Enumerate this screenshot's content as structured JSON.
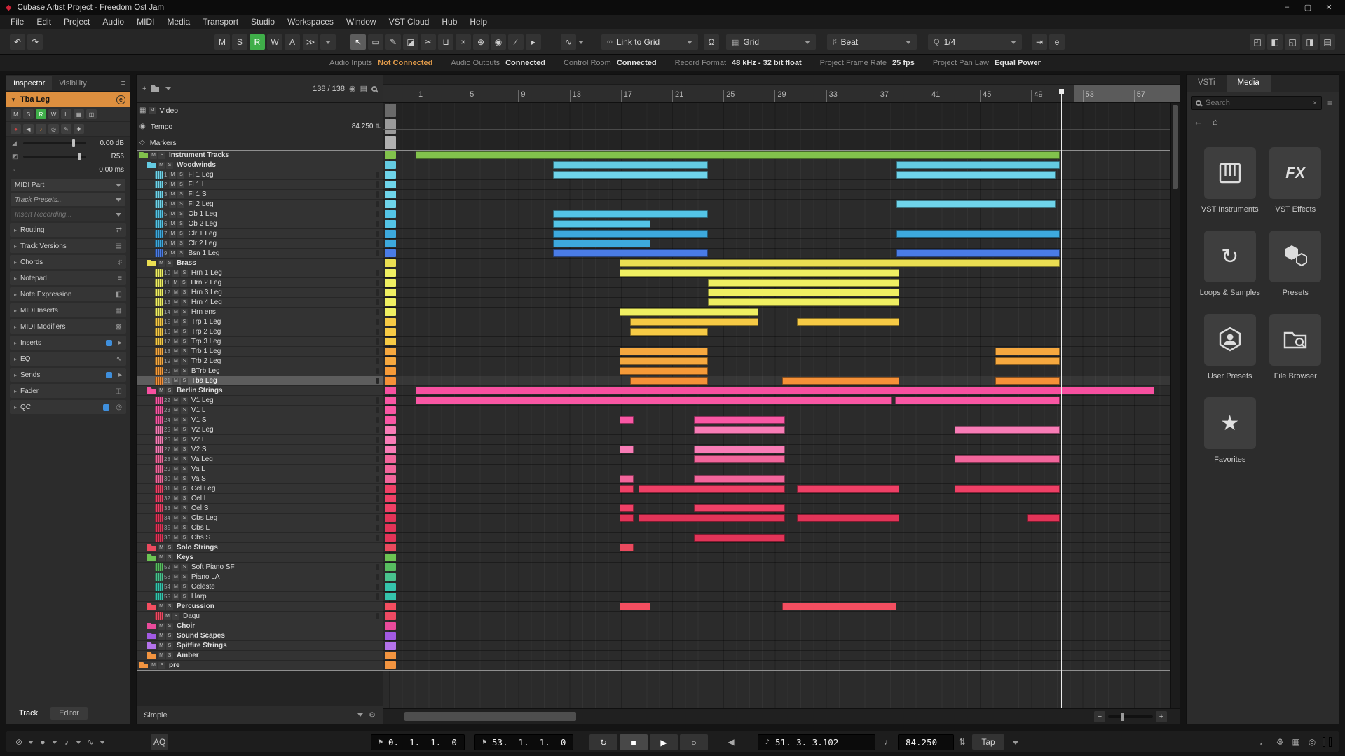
{
  "window": {
    "title": "Cubase Artist Project - Freedom Ost Jam",
    "controls": {
      "minimize": "–",
      "maximize": "▢",
      "close": "✕"
    }
  },
  "menu": {
    "items": [
      "File",
      "Edit",
      "Project",
      "Audio",
      "MIDI",
      "Media",
      "Transport",
      "Studio",
      "Workspaces",
      "Window",
      "VST Cloud",
      "Hub",
      "Help"
    ]
  },
  "icons": {
    "undo": "↶",
    "redo": "↷",
    "autoscroll": "≫",
    "automation": "∿",
    "link": "∞",
    "snap": "Ω",
    "grid": "▦",
    "beat": "♯",
    "quantize": "Q",
    "plus": "+",
    "camera": "◉",
    "list": "▤",
    "back": "←",
    "home": "⌂",
    "clear": "×",
    "menu": "≡",
    "cycle": "↻",
    "stop": "■",
    "play": "▶",
    "record": "○",
    "speaker": "◀",
    "noteq": "♪",
    "qnote": "♩",
    "spin": "⇅",
    "flag": "⚑",
    "e": "e",
    "gear": "⚙",
    "collapse": "▼"
  },
  "toolbar": {
    "states": [
      {
        "label": "M"
      },
      {
        "label": "S"
      },
      {
        "label": "R",
        "active": true
      },
      {
        "label": "W"
      },
      {
        "label": "A"
      }
    ],
    "tools": [
      {
        "name": "object-selection-tool",
        "glyph": "↖",
        "active": true
      },
      {
        "name": "range-selection-tool",
        "glyph": "▭"
      },
      {
        "name": "draw-tool",
        "glyph": "✎"
      },
      {
        "name": "erase-tool",
        "glyph": "◪"
      },
      {
        "name": "split-tool",
        "glyph": "✂"
      },
      {
        "name": "glue-tool",
        "glyph": "⊔"
      },
      {
        "name": "mute-tool",
        "glyph": "×"
      },
      {
        "name": "zoom-tool",
        "glyph": "⊕"
      },
      {
        "name": "comp-tool",
        "glyph": "◉"
      },
      {
        "name": "line-tool",
        "glyph": "∕"
      },
      {
        "name": "play-tool",
        "glyph": "▸"
      }
    ],
    "extras": [
      {
        "name": "iterative-quantize-button",
        "glyph": "⇥"
      },
      {
        "name": "quantize-panel-button",
        "glyph": "e"
      }
    ],
    "window_toggles": [
      {
        "name": "setup-workspace-button",
        "glyph": "◰"
      },
      {
        "name": "left-zone-toggle",
        "glyph": "◧"
      },
      {
        "name": "lower-zone-toggle",
        "glyph": "◱"
      },
      {
        "name": "right-zone-toggle",
        "glyph": "◨"
      },
      {
        "name": "transport-bar-toggle",
        "glyph": "▤"
      }
    ],
    "link_to_grid": "Link to Grid",
    "grid": "Grid",
    "beat": "Beat",
    "quantize": "1/4"
  },
  "infoline": {
    "items": [
      {
        "label": "Audio Inputs",
        "value": "Not Connected",
        "warn": true
      },
      {
        "label": "Audio Outputs",
        "value": "Connected"
      },
      {
        "label": "Control Room",
        "value": "Connected"
      },
      {
        "label": "Record Format",
        "value": "48 kHz - 32 bit float"
      },
      {
        "label": "Project Frame Rate",
        "value": "25 fps"
      },
      {
        "label": "Project Pan Law",
        "value": "Equal Power"
      }
    ]
  },
  "inspector": {
    "tabs": [
      {
        "label": "Inspector",
        "active": true
      },
      {
        "label": "Visibility"
      }
    ],
    "track_name": "Tba Leg",
    "track_color": "#dd8f3f",
    "state_buttons": [
      {
        "label": "M"
      },
      {
        "label": "S"
      },
      {
        "label": "R",
        "active": true
      },
      {
        "label": "W"
      },
      {
        "label": "L"
      }
    ],
    "record_row": [
      {
        "name": "record-enable-button",
        "glyph": "●",
        "color": "#c84545"
      },
      {
        "name": "monitor-button",
        "glyph": "◀",
        "color": "#bdbdbd"
      },
      {
        "name": "midi-note-button",
        "glyph": "♪",
        "color": "#d78b3c"
      },
      {
        "name": "lock-icon",
        "glyph": "◎",
        "color": "#bdbdbd"
      },
      {
        "name": "edit-icon",
        "glyph": "✎",
        "color": "#bdbdbd"
      },
      {
        "name": "freeze-icon",
        "glyph": "✱",
        "color": "#bdbdbd"
      }
    ],
    "volume": "0.00 dB",
    "pan": "R56",
    "delay": "0.00 ms",
    "rows": {
      "output": "MIDI Part",
      "presets": "Track Presets...",
      "insert_recording": "Insert Recording..."
    },
    "sections": [
      {
        "label": "Routing",
        "icon": "routing-icon"
      },
      {
        "label": "Track Versions",
        "icon": "track-versions-icon"
      },
      {
        "label": "Chords",
        "icon": "chords-icon"
      },
      {
        "label": "Notepad",
        "icon": "notepad-icon"
      },
      {
        "label": "Note Expression",
        "icon": "note-expression-icon"
      },
      {
        "label": "MIDI Inserts",
        "icon": "midi-inserts-icon"
      },
      {
        "label": "MIDI Modifiers",
        "icon": "midi-modifiers-icon"
      },
      {
        "label": "Inserts",
        "icon": "inserts-icon",
        "badge": true
      },
      {
        "label": "EQ",
        "icon": "eq-icon"
      },
      {
        "label": "Sends",
        "icon": "sends-icon",
        "badge": true
      },
      {
        "label": "Fader",
        "icon": "fader-icon"
      },
      {
        "label": "QC",
        "icon": "qc-icon",
        "badge": true
      }
    ],
    "bottom_tabs": [
      {
        "label": "Track",
        "active": true
      },
      {
        "label": "Editor"
      }
    ]
  },
  "track_header": {
    "count": "138 / 138"
  },
  "track_controls": {
    "preset": "Simple"
  },
  "timeline": {
    "ticks": [
      1,
      5,
      9,
      13,
      17,
      21,
      25,
      29,
      33,
      37,
      41,
      45,
      49,
      53,
      57
    ],
    "cursor_bar": 51.35,
    "shade_from_bar": 52.3
  },
  "tempo_track": {
    "value": "84.250"
  },
  "tracks": [
    {
      "name": "Video",
      "kind": "special",
      "color": "#6a6a6a",
      "indent": 0,
      "clips": []
    },
    {
      "name": "Tempo",
      "kind": "special",
      "color": "#9a9a9a",
      "indent": 0,
      "value": "84.250",
      "clips": []
    },
    {
      "name": "Markers",
      "kind": "special",
      "color": "#b0b0b0",
      "indent": 0,
      "clips": []
    },
    {
      "name": "Instrument Tracks",
      "kind": "folder",
      "color": "#82c24c",
      "indent": 0,
      "clips": [
        [
          1,
          51.2
        ]
      ]
    },
    {
      "name": "Woodwinds",
      "kind": "folder",
      "color": "#64cbe2",
      "indent": 1,
      "clips": [
        [
          11.7,
          23.8
        ],
        [
          38.5,
          51.2
        ]
      ]
    },
    {
      "name": "Fl 1 Leg",
      "kind": "midi",
      "num": "1",
      "color": "#6fd4ea",
      "indent": 2,
      "clips": [
        [
          11.7,
          23.8
        ],
        [
          38.5,
          50.9
        ]
      ]
    },
    {
      "name": "Fl 1 L",
      "kind": "midi",
      "num": "2",
      "color": "#6fd4ea",
      "indent": 2,
      "clips": []
    },
    {
      "name": "Fl 1 S",
      "kind": "midi",
      "num": "3",
      "color": "#6fd4ea",
      "indent": 2,
      "clips": []
    },
    {
      "name": "Fl 2 Leg",
      "kind": "midi",
      "num": "4",
      "color": "#6fd4ea",
      "indent": 2,
      "clips": [
        [
          38.5,
          50.9
        ]
      ]
    },
    {
      "name": "Ob 1 Leg",
      "kind": "midi",
      "num": "5",
      "color": "#54c4e6",
      "indent": 2,
      "clips": [
        [
          11.7,
          23.8
        ]
      ]
    },
    {
      "name": "Ob 2 Leg",
      "kind": "midi",
      "num": "6",
      "color": "#54c4e6",
      "indent": 2,
      "clips": [
        [
          11.7,
          19.3
        ]
      ]
    },
    {
      "name": "Clr 1 Leg",
      "kind": "midi",
      "num": "7",
      "color": "#3da9dd",
      "indent": 2,
      "clips": [
        [
          11.7,
          23.8
        ],
        [
          38.5,
          51.2
        ]
      ]
    },
    {
      "name": "Clr 2 Leg",
      "kind": "midi",
      "num": "8",
      "color": "#3da9dd",
      "indent": 2,
      "clips": [
        [
          11.7,
          19.3
        ]
      ]
    },
    {
      "name": "Bsn 1 Leg",
      "kind": "midi",
      "num": "9",
      "color": "#4a7ce6",
      "indent": 2,
      "clips": [
        [
          11.7,
          23.8
        ],
        [
          38.5,
          51.2
        ]
      ]
    },
    {
      "name": "Brass",
      "kind": "folder",
      "color": "#eade52",
      "indent": 1,
      "clips": [
        [
          16.9,
          51.2
        ]
      ]
    },
    {
      "name": "Hrn 1 Leg",
      "kind": "midi",
      "num": "10",
      "color": "#efef62",
      "indent": 2,
      "clips": [
        [
          16.9,
          38.7
        ]
      ]
    },
    {
      "name": "Hrn 2 Leg",
      "kind": "midi",
      "num": "11",
      "color": "#efef62",
      "indent": 2,
      "clips": [
        [
          23.8,
          38.7
        ]
      ]
    },
    {
      "name": "Hrn 3 Leg",
      "kind": "midi",
      "num": "12",
      "color": "#efef62",
      "indent": 2,
      "clips": [
        [
          23.8,
          38.7
        ]
      ]
    },
    {
      "name": "Hrn 4 Leg",
      "kind": "midi",
      "num": "13",
      "color": "#efef62",
      "indent": 2,
      "clips": [
        [
          23.8,
          38.7
        ]
      ]
    },
    {
      "name": "Hrn ens",
      "kind": "midi",
      "num": "14",
      "color": "#efef62",
      "indent": 2,
      "clips": [
        [
          16.9,
          27.7
        ]
      ]
    },
    {
      "name": "Trp 1 Leg",
      "kind": "midi",
      "num": "15",
      "color": "#f6ca45",
      "indent": 2,
      "clips": [
        [
          17.7,
          27.7
        ],
        [
          30.7,
          38.7
        ]
      ]
    },
    {
      "name": "Trp 2 Leg",
      "kind": "midi",
      "num": "16",
      "color": "#f6ca45",
      "indent": 2,
      "clips": [
        [
          17.7,
          23.8
        ]
      ]
    },
    {
      "name": "Trp 3 Leg",
      "kind": "midi",
      "num": "17",
      "color": "#f6ca45",
      "indent": 2,
      "clips": []
    },
    {
      "name": "Trb 1 Leg",
      "kind": "midi",
      "num": "18",
      "color": "#f6a83f",
      "indent": 2,
      "clips": [
        [
          16.9,
          23.8
        ],
        [
          46.2,
          51.2
        ]
      ]
    },
    {
      "name": "Trb 2 Leg",
      "kind": "midi",
      "num": "19",
      "color": "#f6a83f",
      "indent": 2,
      "clips": [
        [
          16.9,
          23.8
        ],
        [
          46.2,
          51.2
        ]
      ]
    },
    {
      "name": "BTrb Leg",
      "kind": "midi",
      "num": "20",
      "color": "#f69a38",
      "indent": 2,
      "clips": [
        [
          16.9,
          23.8
        ]
      ]
    },
    {
      "name": "Tba Leg",
      "kind": "midi",
      "num": "21",
      "color": "#f69138",
      "indent": 2,
      "selected": true,
      "clips": [
        [
          17.7,
          23.8
        ],
        [
          29.6,
          38.7
        ],
        [
          46.2,
          51.2
        ]
      ]
    },
    {
      "name": "Berlin Strings",
      "kind": "folder",
      "color": "#f750a0",
      "indent": 1,
      "clips": [
        [
          1,
          58.6
        ]
      ]
    },
    {
      "name": "V1 Leg",
      "kind": "midi",
      "num": "22",
      "color": "#f957a4",
      "indent": 2,
      "clips": [
        [
          1,
          38.1
        ],
        [
          38.4,
          51.2
        ]
      ]
    },
    {
      "name": "V1 L",
      "kind": "midi",
      "num": "23",
      "color": "#f957a4",
      "indent": 2,
      "clips": []
    },
    {
      "name": "V1 S",
      "kind": "midi",
      "num": "24",
      "color": "#f957a4",
      "indent": 2,
      "clips": [
        [
          16.9,
          18
        ],
        [
          22.7,
          29.8
        ]
      ]
    },
    {
      "name": "V2 Leg",
      "kind": "midi",
      "num": "25",
      "color": "#f87cb6",
      "indent": 2,
      "clips": [
        [
          22.7,
          29.8
        ],
        [
          43,
          51.2
        ]
      ]
    },
    {
      "name": "V2 L",
      "kind": "midi",
      "num": "26",
      "color": "#f87cb6",
      "indent": 2,
      "clips": []
    },
    {
      "name": "V2 S",
      "kind": "midi",
      "num": "27",
      "color": "#f87cb6",
      "indent": 2,
      "clips": [
        [
          16.9,
          18
        ],
        [
          22.7,
          29.8
        ]
      ]
    },
    {
      "name": "Va Leg",
      "kind": "midi",
      "num": "28",
      "color": "#f2659b",
      "indent": 2,
      "clips": [
        [
          22.7,
          29.8
        ],
        [
          43,
          51.2
        ]
      ]
    },
    {
      "name": "Va L",
      "kind": "midi",
      "num": "29",
      "color": "#f2659b",
      "indent": 2,
      "clips": []
    },
    {
      "name": "Va S",
      "kind": "midi",
      "num": "30",
      "color": "#f2659b",
      "indent": 2,
      "clips": [
        [
          16.9,
          18
        ],
        [
          22.7,
          29.8
        ]
      ]
    },
    {
      "name": "Cel Leg",
      "kind": "midi",
      "num": "31",
      "color": "#ef4066",
      "indent": 2,
      "clips": [
        [
          16.9,
          18
        ],
        [
          18.4,
          29.8
        ],
        [
          30.7,
          38.7
        ],
        [
          43,
          51.2
        ]
      ]
    },
    {
      "name": "Cel L",
      "kind": "midi",
      "num": "32",
      "color": "#ef4066",
      "indent": 2,
      "clips": []
    },
    {
      "name": "Cel S",
      "kind": "midi",
      "num": "33",
      "color": "#ef4066",
      "indent": 2,
      "clips": [
        [
          16.9,
          18
        ],
        [
          22.7,
          29.8
        ]
      ]
    },
    {
      "name": "Cbs Leg",
      "kind": "midi",
      "num": "34",
      "color": "#e23458",
      "indent": 2,
      "clips": [
        [
          16.9,
          18
        ],
        [
          18.4,
          29.8
        ],
        [
          30.7,
          38.7
        ],
        [
          48.7,
          51.2
        ]
      ]
    },
    {
      "name": "Cbs L",
      "kind": "midi",
      "num": "35",
      "color": "#e23458",
      "indent": 2,
      "clips": []
    },
    {
      "name": "Cbs S",
      "kind": "midi",
      "num": "36",
      "color": "#e23458",
      "indent": 2,
      "clips": [
        [
          22.7,
          29.8
        ]
      ]
    },
    {
      "name": "Solo Strings",
      "kind": "folder",
      "color": "#ea4a5e",
      "indent": 1,
      "clips": [
        [
          16.9,
          18
        ]
      ]
    },
    {
      "name": "Keys",
      "kind": "folder",
      "color": "#6cc453",
      "indent": 1,
      "clips": []
    },
    {
      "name": "Soft Piano SF",
      "kind": "midi",
      "num": "52",
      "color": "#57bd60",
      "indent": 2,
      "clips": []
    },
    {
      "name": "Piano LA",
      "kind": "midi",
      "num": "53",
      "color": "#49c28e",
      "indent": 2,
      "clips": []
    },
    {
      "name": "Celeste",
      "kind": "midi",
      "num": "54",
      "color": "#35c3ac",
      "indent": 2,
      "clips": []
    },
    {
      "name": "Harp",
      "kind": "midi",
      "num": "55",
      "color": "#35c3ac",
      "indent": 2,
      "clips": []
    },
    {
      "name": "Percussion",
      "kind": "folder",
      "color": "#f34e60",
      "indent": 1,
      "clips": [
        [
          16.9,
          19.3
        ],
        [
          29.6,
          38.5
        ]
      ]
    },
    {
      "name": "Daqu",
      "kind": "midi",
      "num": "",
      "color": "#ee4a63",
      "indent": 2,
      "clips": []
    },
    {
      "name": "Choir",
      "kind": "folder",
      "color": "#e94b9b",
      "indent": 1,
      "clips": []
    },
    {
      "name": "Sound Scapes",
      "kind": "folder",
      "color": "#a25ae2",
      "indent": 1,
      "clips": []
    },
    {
      "name": "Spitfire Strings",
      "kind": "folder",
      "color": "#b473ea",
      "indent": 1,
      "clips": []
    },
    {
      "name": "Amber",
      "kind": "folder",
      "color": "#f29440",
      "indent": 1,
      "clips": []
    },
    {
      "name": "pre",
      "kind": "folder",
      "color": "#f29440",
      "indent": 0,
      "clips": []
    }
  ],
  "media": {
    "tabs": [
      {
        "label": "VSTi"
      },
      {
        "label": "Media",
        "active": true
      }
    ],
    "search_placeholder": "Search",
    "tiles": [
      {
        "label": "VST Instruments",
        "icon": "piano"
      },
      {
        "label": "VST Effects",
        "icon": "fx"
      },
      {
        "label": "Loops & Samples",
        "icon": "loop"
      },
      {
        "label": "Presets",
        "icon": "hexagons"
      },
      {
        "label": "User Presets",
        "icon": "user-preset"
      },
      {
        "label": "File Browser",
        "icon": "file-browser"
      },
      {
        "label": "Favorites",
        "icon": "star"
      }
    ]
  },
  "transport": {
    "left_icons": [
      {
        "name": "constrain-delay-icon",
        "glyph": "⊘"
      },
      {
        "name": "record-modes-icon",
        "glyph": "●"
      },
      {
        "name": "midi-record-mode-icon",
        "glyph": "♪"
      },
      {
        "name": "audio-record-mode-icon",
        "glyph": "∿"
      }
    ],
    "aq": "AQ",
    "left_locator": "0.  1.  1.  0",
    "right_locator": "53.  1.  1.  0",
    "position": "51. 3. 3.102",
    "tempo": "84.250",
    "tap": "Tap",
    "right_icons": [
      {
        "name": "metronome-icon",
        "glyph": "♩"
      },
      {
        "name": "settings-icon",
        "glyph": "⚙"
      },
      {
        "name": "onscreen-keyboard-icon",
        "glyph": "▦"
      },
      {
        "name": "lock-icon",
        "glyph": "◎"
      }
    ]
  }
}
